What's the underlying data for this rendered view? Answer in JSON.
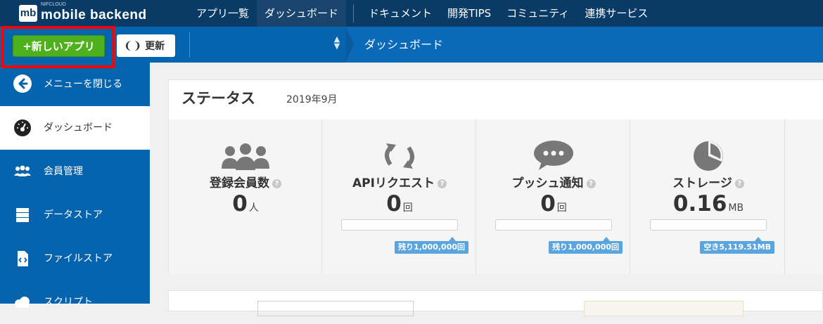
{
  "header": {
    "logo_badge": "mb",
    "logo_small": "NIFCLOUD",
    "logo_text": "mobile backend",
    "nav": [
      "アプリ一覧",
      "ダッシュボード",
      "ドキュメント",
      "開発TIPS",
      "コミュニティ",
      "連携サービス"
    ],
    "active_nav": "ダッシュボード"
  },
  "toolbar": {
    "new_app_label": "+新しいアプリ",
    "refresh_label": "更新",
    "breadcrumb": "ダッシュボード"
  },
  "sidebar": {
    "items": [
      {
        "label": "メニューを閉じる",
        "icon": "arrow-left-circle-icon"
      },
      {
        "label": "ダッシュボード",
        "icon": "speedometer-icon",
        "active": true
      },
      {
        "label": "会員管理",
        "icon": "users-icon"
      },
      {
        "label": "データストア",
        "icon": "database-icon"
      },
      {
        "label": "ファイルストア",
        "icon": "code-file-icon"
      },
      {
        "label": "スクリプト",
        "icon": "cloud-icon"
      }
    ]
  },
  "status": {
    "title": "ステータス",
    "date": "2019年9月",
    "cards": [
      {
        "title": "登録会員数",
        "value": "0",
        "unit": "人",
        "icon": "users-icon"
      },
      {
        "title": "APIリクエスト",
        "value": "0",
        "unit": "回",
        "remaining": "残り1,000,000回",
        "icon": "refresh-icon"
      },
      {
        "title": "プッシュ通知",
        "value": "0",
        "unit": "回",
        "remaining": "残り1,000,000回",
        "icon": "chat-bubble-icon"
      },
      {
        "title": "ストレージ",
        "value": "0.16",
        "unit": "MB",
        "remaining": "空き5,119.51MB",
        "icon": "pie-chart-icon"
      }
    ],
    "help_mark": "?"
  },
  "colors": {
    "header": "#0a3a66",
    "subbar": "#0663ae",
    "new_button": "#4fb01e",
    "highlight": "#ff0000",
    "tooltip": "#5aa5e0"
  }
}
